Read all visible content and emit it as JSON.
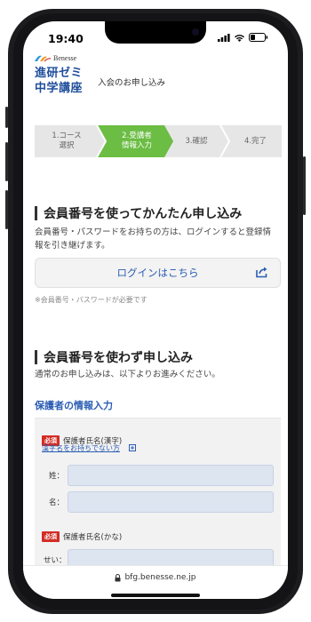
{
  "status_bar": {
    "time": "19:40"
  },
  "header": {
    "brand": "Benesse",
    "course_name": "進研ゼミ\n中学講座",
    "page_name": "入会のお申し込み"
  },
  "steps": [
    {
      "label": "1.コース\n選択",
      "state": "done"
    },
    {
      "label": "2.受講者\n情報入力",
      "state": "active"
    },
    {
      "label": "3.確認",
      "state": "todo"
    },
    {
      "label": "4.完了",
      "state": "todo"
    }
  ],
  "member_section": {
    "title": "会員番号を使ってかんたん申し込み",
    "description": "会員番号・パスワードをお持ちの方は、ログインすると登録情報を引き継げます。",
    "login_button": "ログインはこちら",
    "note": "※会員番号・パスワードが必要です"
  },
  "nonmember_section": {
    "title": "会員番号を使わず申し込み",
    "description": "通常のお申し込みは、以下よりお進みください。",
    "sub_heading": "保護者の情報入力"
  },
  "form": {
    "required_badge": "必須",
    "kanji_name": {
      "label": "保護者氏名(漢字)",
      "help_link": "漢字名をお持ちでない方",
      "last_label": "姓：",
      "first_label": "名："
    },
    "kana_name": {
      "label": "保護者氏名(かな)",
      "last_label": "せい："
    }
  },
  "url_bar": {
    "url": "bfg.benesse.ne.jp"
  },
  "colors": {
    "accent_blue": "#2b5db3",
    "step_active_green": "#6bbd43",
    "required_red": "#d32d26",
    "input_blue": "#dde5f1"
  }
}
